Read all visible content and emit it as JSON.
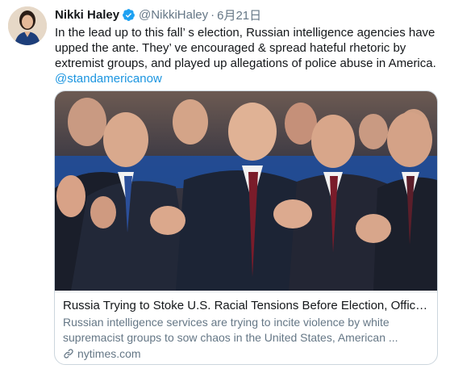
{
  "tweet": {
    "author_name": "Nikki Haley",
    "handle": "@NikkiHaley",
    "separator": "·",
    "date": "6月21日",
    "text_main": "In the lead up to this fall’ s election, Russian intelligence agencies have upped the ante. They’ ve encouraged & spread hateful rhetoric by extremist groups, and played up allegations of police abuse in America. ",
    "mention": "@standamericanow"
  },
  "card": {
    "title": "Russia Trying to Stoke U.S. Racial Tensions Before Election, Officia...",
    "description": "Russian intelligence services are trying to incite violence by white supremacist groups to sow chaos in the United States, American ...",
    "domain": "nytimes.com"
  },
  "icons": {
    "verified": "verified-badge-icon",
    "link": "link-icon"
  },
  "colors": {
    "link_blue": "#1b95e0",
    "muted": "#657786",
    "border": "#ccd6dd"
  }
}
